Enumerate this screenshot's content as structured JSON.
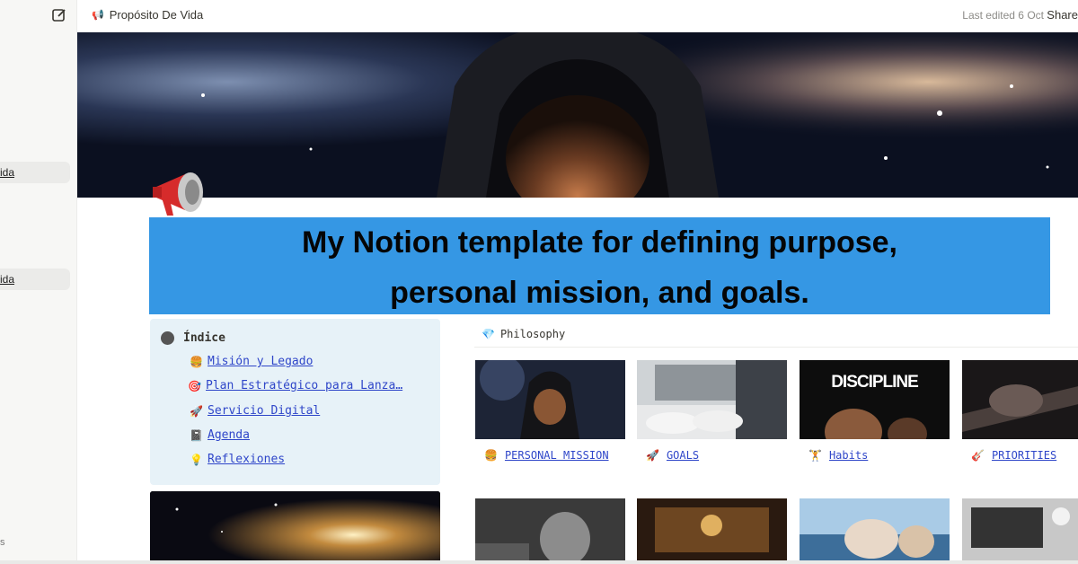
{
  "sidebar": {
    "items": [
      {
        "label": "ida"
      },
      {
        "label": "ida"
      }
    ],
    "footer": "s"
  },
  "topbar": {
    "breadcrumb_icon": "megaphone-icon",
    "breadcrumb": "Propósito De Vida",
    "last_edited": "Last edited 6 Oct",
    "share": "Share"
  },
  "banner": {
    "line1": "My Notion template for defining purpose,",
    "line2": "personal mission, and goals.",
    "color": "#3597e4"
  },
  "index": {
    "title": "Índice",
    "items": [
      {
        "icon": "🍔",
        "label": "Misión y Legado"
      },
      {
        "icon": "🎯",
        "label": "Plan Estratégico para Lanza…"
      },
      {
        "icon": "🚀",
        "label": "Servicio Digital"
      },
      {
        "icon": "📓",
        "label": "Agenda"
      },
      {
        "icon": "💡",
        "label": "Reflexiones"
      }
    ]
  },
  "philosophy": {
    "title": "Philosophy",
    "cards": [
      {
        "icon": "🍔",
        "label": "PERSONAL MISSION"
      },
      {
        "icon": "🚀",
        "label": "GOALS"
      },
      {
        "icon": "🏋",
        "label": "Habits",
        "image_text": "DISCIPLINE"
      },
      {
        "icon": "🎸",
        "label": "PRIORITIES"
      }
    ]
  },
  "colors": {
    "link": "#2f46c9",
    "index_bg": "#e7f2f8"
  }
}
